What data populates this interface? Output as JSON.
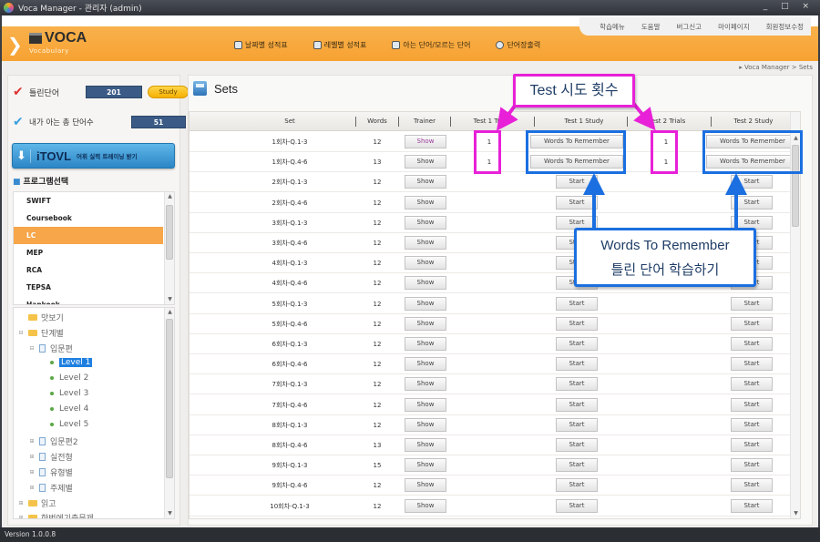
{
  "window": {
    "title": "Voca Manager - 관리자 (admin)",
    "controls": "_ □ ×"
  },
  "header": {
    "logo_title": "VOCA",
    "logo_subtitle": "Vocabulary",
    "nav": [
      {
        "label": "날짜별 성적표",
        "icon": "report-icon"
      },
      {
        "label": "레벨별 성적표",
        "icon": "chart-icon"
      },
      {
        "label": "아는 단어/모르는 단어",
        "icon": "book-icon"
      },
      {
        "label": "단어장출력",
        "icon": "print-icon"
      }
    ],
    "top_links": [
      "학습메뉴",
      "도움말",
      "버그신고",
      "마이페이지",
      "회원정보수정"
    ]
  },
  "breadcrumb": "▸ Voca Manager > Sets",
  "sidebar": {
    "wrong_words": {
      "label": "틀린단어",
      "value": "201",
      "button": "Study"
    },
    "known_words": {
      "label": "내가 아는 총 단어수",
      "value": "51"
    },
    "itovl": {
      "brand": "iTOVL",
      "label": "어휘 실력 트레이닝 받기"
    },
    "program_title": "프로그램선택",
    "programs": [
      "SWIFT",
      "Coursebook",
      "LC",
      "MEP",
      "RCA",
      "TEPSA",
      "Hankook"
    ],
    "selected_program": "LC",
    "tree": [
      {
        "label": "맛보기",
        "type": "folder",
        "level": 0
      },
      {
        "label": "단계별",
        "type": "folder",
        "level": 0
      },
      {
        "label": "입문편",
        "type": "doc",
        "level": 1
      },
      {
        "label": "Level 1",
        "type": "leaf",
        "level": 2,
        "selected": true
      },
      {
        "label": "Level 2",
        "type": "leaf",
        "level": 2
      },
      {
        "label": "Level 3",
        "type": "leaf",
        "level": 2
      },
      {
        "label": "Level 4",
        "type": "leaf",
        "level": 2
      },
      {
        "label": "Level 5",
        "type": "leaf",
        "level": 2
      },
      {
        "label": "입문편2",
        "type": "doc",
        "level": 1
      },
      {
        "label": "실전형",
        "type": "doc",
        "level": 1
      },
      {
        "label": "유형별",
        "type": "doc",
        "level": 1
      },
      {
        "label": "주제별",
        "type": "doc",
        "level": 1
      },
      {
        "label": "읽고",
        "type": "folder",
        "level": 0
      },
      {
        "label": "한번에기출문제",
        "type": "folder",
        "level": 0
      }
    ]
  },
  "main": {
    "title": "Sets",
    "columns": [
      "Set",
      "Words",
      "Trainer",
      "Test 1 Trials",
      "Test 1 Study",
      "Test 2 Trials",
      "Test 2 Study"
    ],
    "rows": [
      {
        "set": "1회차-Q.1-3",
        "words": "12",
        "trainer": "Show",
        "t1_trials": "1",
        "t1_study": "Words To Remember",
        "t2_trials": "1",
        "t2_study": "Words To Remember"
      },
      {
        "set": "1회차-Q.4-6",
        "words": "13",
        "trainer": "Show",
        "t1_trials": "1",
        "t1_study": "Words To Remember",
        "t2_trials": "1",
        "t2_study": "Words To Remember"
      },
      {
        "set": "2회차-Q.1-3",
        "words": "12",
        "trainer": "Show",
        "t1_trials": "",
        "t1_study": "Start",
        "t2_trials": "",
        "t2_study": "Start"
      },
      {
        "set": "2회차-Q.4-6",
        "words": "12",
        "trainer": "Show",
        "t1_trials": "",
        "t1_study": "Start",
        "t2_trials": "",
        "t2_study": "Start"
      },
      {
        "set": "3회차-Q.1-3",
        "words": "12",
        "trainer": "Show",
        "t1_trials": "",
        "t1_study": "Start",
        "t2_trials": "",
        "t2_study": "Start"
      },
      {
        "set": "3회차-Q.4-6",
        "words": "12",
        "trainer": "Show",
        "t1_trials": "",
        "t1_study": "Start",
        "t2_trials": "",
        "t2_study": "Start"
      },
      {
        "set": "4회차-Q.1-3",
        "words": "12",
        "trainer": "Show",
        "t1_trials": "",
        "t1_study": "Start",
        "t2_trials": "",
        "t2_study": "Start"
      },
      {
        "set": "4회차-Q.4-6",
        "words": "12",
        "trainer": "Show",
        "t1_trials": "",
        "t1_study": "Start",
        "t2_trials": "",
        "t2_study": "Start"
      },
      {
        "set": "5회차-Q.1-3",
        "words": "12",
        "trainer": "Show",
        "t1_trials": "",
        "t1_study": "Start",
        "t2_trials": "",
        "t2_study": "Start"
      },
      {
        "set": "5회차-Q.4-6",
        "words": "12",
        "trainer": "Show",
        "t1_trials": "",
        "t1_study": "Start",
        "t2_trials": "",
        "t2_study": "Start"
      },
      {
        "set": "6회차-Q.1-3",
        "words": "12",
        "trainer": "Show",
        "t1_trials": "",
        "t1_study": "Start",
        "t2_trials": "",
        "t2_study": "Start"
      },
      {
        "set": "6회차-Q.4-6",
        "words": "12",
        "trainer": "Show",
        "t1_trials": "",
        "t1_study": "Start",
        "t2_trials": "",
        "t2_study": "Start"
      },
      {
        "set": "7회차-Q.1-3",
        "words": "12",
        "trainer": "Show",
        "t1_trials": "",
        "t1_study": "Start",
        "t2_trials": "",
        "t2_study": "Start"
      },
      {
        "set": "7회차-Q.4-6",
        "words": "12",
        "trainer": "Show",
        "t1_trials": "",
        "t1_study": "Start",
        "t2_trials": "",
        "t2_study": "Start"
      },
      {
        "set": "8회차-Q.1-3",
        "words": "12",
        "trainer": "Show",
        "t1_trials": "",
        "t1_study": "Start",
        "t2_trials": "",
        "t2_study": "Start"
      },
      {
        "set": "8회차-Q.4-6",
        "words": "13",
        "trainer": "Show",
        "t1_trials": "",
        "t1_study": "Start",
        "t2_trials": "",
        "t2_study": "Start"
      },
      {
        "set": "9회차-Q.1-3",
        "words": "15",
        "trainer": "Show",
        "t1_trials": "",
        "t1_study": "Start",
        "t2_trials": "",
        "t2_study": "Start"
      },
      {
        "set": "9회차-Q.4-6",
        "words": "12",
        "trainer": "Show",
        "t1_trials": "",
        "t1_study": "Start",
        "t2_trials": "",
        "t2_study": "Start"
      },
      {
        "set": "10회차-Q.1-3",
        "words": "12",
        "trainer": "Show",
        "t1_trials": "",
        "t1_study": "Start",
        "t2_trials": "",
        "t2_study": "Start"
      }
    ]
  },
  "annotations": {
    "trials_callout": "Test 시도 횟수",
    "study_callout_line1": "Words To Remember",
    "study_callout_line2": "틀린 단어 학습하기",
    "pink": "#e821d8",
    "blue": "#1b6fe0"
  },
  "statusbar": {
    "version": "Version 1.0.0.8"
  },
  "colors": {
    "header_orange": "#f7a232",
    "stat_blue": "#3b5b86",
    "selected_orange": "#f7a64a",
    "tree_select": "#1e7fe0"
  }
}
